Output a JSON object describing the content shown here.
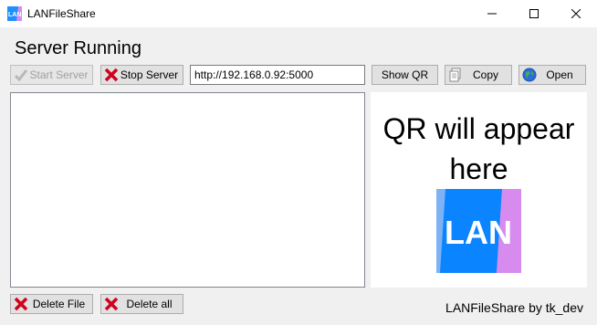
{
  "window": {
    "title": "LANFileShare",
    "app_icon_text": "LAN"
  },
  "status_text": "Server Running",
  "toolbar": {
    "start_label": "Start Server",
    "stop_label": "Stop Server",
    "url_value": "http://192.168.0.92:5000",
    "show_qr_label": "Show QR",
    "copy_label": "Copy",
    "open_label": "Open"
  },
  "qr": {
    "placeholder_text": "QR will appear here",
    "logo_text": "LAN"
  },
  "bottom": {
    "delete_file_label": "Delete File",
    "delete_all_label": "Delete all"
  },
  "footer_text": "LANFileShare by tk_dev",
  "colors": {
    "accent": "#0b84ff",
    "logo_blue": "#1e8fff",
    "logo_purple": "#d88bef",
    "url_border": "#7a7a7a"
  }
}
